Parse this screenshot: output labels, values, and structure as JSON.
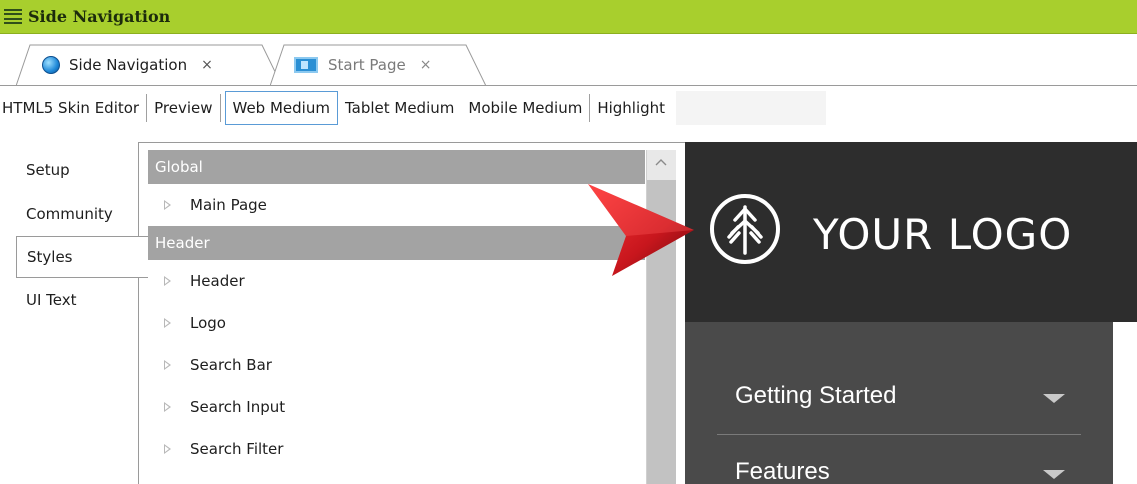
{
  "window": {
    "title": "Side Navigation"
  },
  "tabs": [
    {
      "label": "Side Navigation",
      "icon": "globe-icon",
      "close": "×",
      "active": true
    },
    {
      "label": "Start Page",
      "icon": "page-icon",
      "close": "×",
      "active": false
    }
  ],
  "toolbar": {
    "items": [
      "HTML5 Skin Editor",
      "Preview",
      "Web Medium",
      "Tablet Medium",
      "Mobile Medium",
      "Highlight"
    ],
    "active_item": "Web Medium"
  },
  "left_nav": {
    "items": [
      "Setup",
      "Community",
      "Styles",
      "UI Text"
    ],
    "active": "Styles"
  },
  "tree": {
    "groups": [
      {
        "header": "Global",
        "rows": [
          "Main Page"
        ]
      },
      {
        "header": "Header",
        "rows": [
          "Header",
          "Logo",
          "Search Bar",
          "Search Input",
          "Search Filter"
        ]
      }
    ]
  },
  "preview": {
    "logo_text": "YOUR LOGO",
    "nav_items": [
      "Getting Started",
      "Features"
    ],
    "header_color": "#2d2d2d",
    "nav_color": "#4a4a4a"
  },
  "colors": {
    "titlebar": "#a8cf2d",
    "tree_header": "#a3a3a3",
    "arrow": "#c8161d",
    "active_border": "#5a9bd6"
  }
}
